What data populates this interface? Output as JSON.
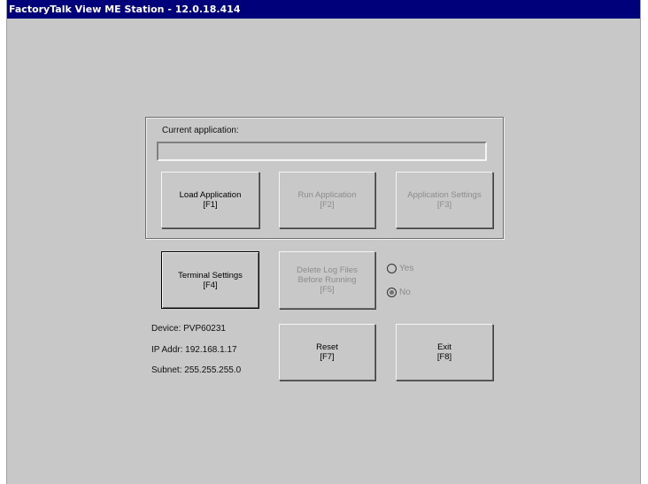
{
  "window": {
    "title": "FactoryTalk View ME Station - 12.0.18.414"
  },
  "current_application": {
    "label": "Current application:",
    "value": ""
  },
  "buttons": {
    "load_application": {
      "label": "Load Application",
      "key": "[F1]"
    },
    "run_application": {
      "label": "Run Application",
      "key": "[F2]"
    },
    "application_settings": {
      "label": "Application Settings",
      "key": "[F3]"
    },
    "terminal_settings": {
      "label": "Terminal Settings",
      "key": "[F4]"
    },
    "delete_log_files": {
      "line1": "Delete Log Files",
      "line2": "Before Running",
      "key": "[F5]"
    },
    "reset": {
      "label": "Reset",
      "key": "[F7]"
    },
    "exit": {
      "label": "Exit",
      "key": "[F8]"
    }
  },
  "delete_log_option": {
    "yes_label": "Yes",
    "no_label": "No",
    "selected": "No"
  },
  "device_info": {
    "device": "Device: PVP60231",
    "ip": "IP Addr: 192.168.1.17",
    "subnet": "Subnet: 255.255.255.0"
  }
}
